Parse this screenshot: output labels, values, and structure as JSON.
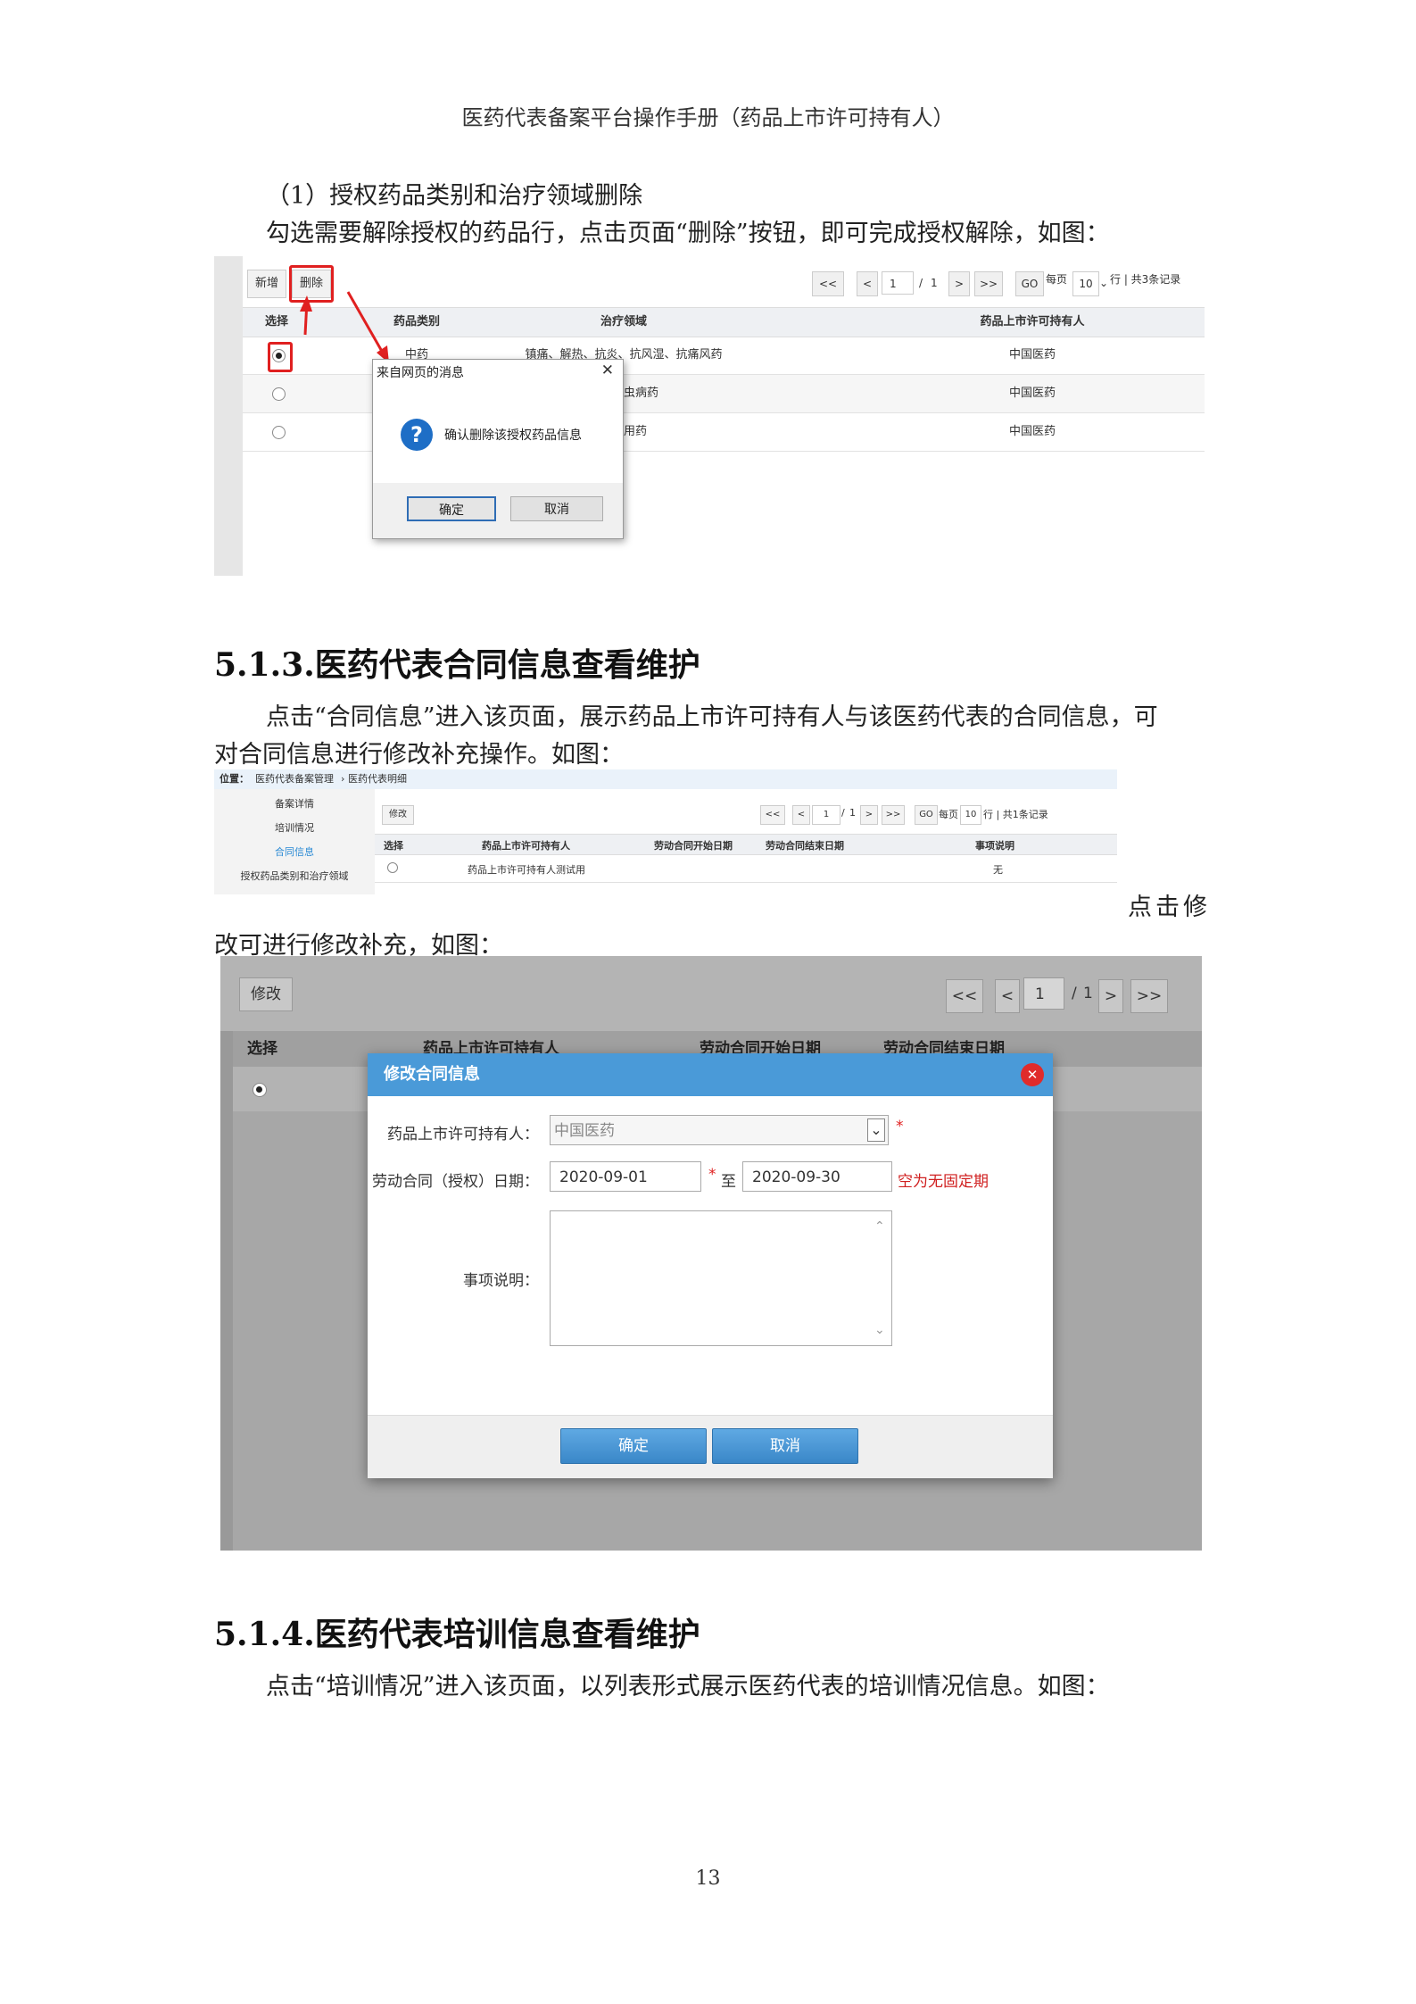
{
  "header": {
    "title": "医药代表备案平台操作手册（药品上市许可持有人）"
  },
  "section_1": {
    "subtitle": "（1）授权药品类别和治疗领域删除",
    "instruction": "勾选需要解除授权的药品行，点击页面“删除”按钮，即可完成授权解除，如图："
  },
  "screenshot_1": {
    "toolbar": {
      "add": "新增",
      "delete": "删除"
    },
    "pager": {
      "first": "<<",
      "prev": "<",
      "page": "1",
      "slash": "/",
      "total_pages": "1",
      "next": ">",
      "last": ">>",
      "go": "GO",
      "per_page_label": "每页",
      "per_page": "10",
      "summary": "行 | 共3条记录"
    },
    "columns": [
      "选择",
      "药品类别",
      "治疗领域",
      "药品上市许可持有人"
    ],
    "rows": [
      {
        "selected": true,
        "category": "中药",
        "field": "镇痛、解热、抗炎、抗风湿、抗痛风药",
        "holder": "中国医药"
      },
      {
        "selected": false,
        "category": "",
        "field": "抗寄生虫病药",
        "holder": "中国医药"
      },
      {
        "selected": false,
        "category": "",
        "field": "内科用药",
        "holder": "中国医药"
      }
    ],
    "dialog": {
      "title": "来自网页的消息",
      "close": "✕",
      "icon": "question-icon",
      "message": "确认删除该授权药品信息",
      "ok": "确定",
      "cancel": "取消"
    },
    "accent_red": "#e02020"
  },
  "section_513": {
    "heading": "5.1.3.医药代表合同信息查看维护",
    "intro_line1": "点击“合同信息”进入该页面，展示药品上市许可持有人与该医药代表的合同信息，可",
    "intro_line2": "对合同信息进行修改补充操作。如图：",
    "after_line1": "点击修",
    "after_line2": "改可进行修改补充，如图："
  },
  "screenshot_2": {
    "breadcrumb": {
      "label": "位置：",
      "path1": "医药代表备案管理",
      "sep": "›",
      "path2": "医药代表明细"
    },
    "sidebar": [
      "备案详情",
      "培训情况",
      "合同信息",
      "授权药品类别和治疗领域"
    ],
    "toolbar": {
      "edit": "修改"
    },
    "pager": {
      "first": "<<",
      "prev": "<",
      "page": "1",
      "slash": "/",
      "total_pages": "1",
      "next": ">",
      "last": ">>",
      "go": "GO",
      "per_page_label": "每页",
      "per_page": "10",
      "summary": "行 | 共1条记录"
    },
    "columns": [
      "选择",
      "药品上市许可持有人",
      "劳动合同开始日期",
      "劳动合同结束日期",
      "事项说明"
    ],
    "rows": [
      {
        "holder": "药品上市许可持有人测试用",
        "start": "",
        "end": "",
        "note": "无"
      }
    ]
  },
  "screenshot_3": {
    "toolbar": {
      "edit": "修改"
    },
    "pager": {
      "first": "<<",
      "prev": "<",
      "page": "1",
      "slash": "/",
      "total_pages": "1",
      "next": ">",
      "last": ">>"
    },
    "columns": [
      "选择",
      "药品上市许可持有人",
      "劳动合同开始日期",
      "劳动合同结束日期"
    ],
    "dialog": {
      "title": "修改合同信息",
      "close": "✕",
      "holder_label": "药品上市许可持有人：",
      "holder_value": "中国医药",
      "date_label": "劳动合同（授权）日期：",
      "start_date": "2020-09-01",
      "to": "至",
      "end_date": "2020-09-30",
      "required": "*",
      "hint": "空为无固定期",
      "note_label": "事项说明：",
      "note_value": "",
      "ok": "确定",
      "cancel": "取消"
    },
    "accent_blue": "#4a9ad8"
  },
  "section_514": {
    "heading": "5.1.4.医药代表培训信息查看维护",
    "intro": "点击“培训情况”进入该页面，以列表形式展示医药代表的培训情况信息。如图："
  },
  "footer": {
    "page_number": "13"
  }
}
